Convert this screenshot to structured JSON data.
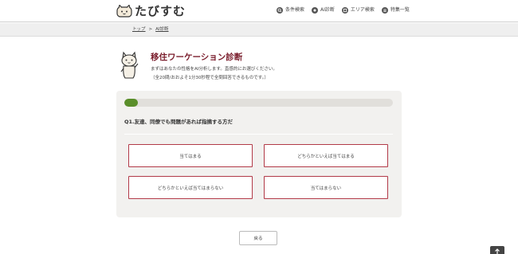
{
  "header": {
    "logo_text": "たびすむ",
    "nav": [
      {
        "label": "条件検索",
        "icon": "search-icon"
      },
      {
        "label": "AI診断",
        "icon": "ai-icon"
      },
      {
        "label": "エリア検索",
        "icon": "area-icon"
      },
      {
        "label": "特集一覧",
        "icon": "feature-list-icon"
      }
    ]
  },
  "breadcrumb": {
    "home": "トップ",
    "separator": ">",
    "current": "AI診断"
  },
  "intro": {
    "title": "移住ワーケーション診断",
    "line1": "まずはあなたの性格をAI分析します。直感的にお選びください。",
    "line2": "（全20問/おおよそ1分30秒程で全問回答できるものです。）"
  },
  "quiz": {
    "progress_fraction": 0.05,
    "question": "Q1.友達、同僚でも問題があれば指摘する方だ",
    "answers": [
      "当てはまる",
      "どちらかといえば当てはまる",
      "どちらかといえば当てはまらない",
      "当てはまらない"
    ],
    "accent_color": "#5a8e2a",
    "border_color": "#b23a48"
  },
  "footer": {
    "back_label": "戻る"
  }
}
